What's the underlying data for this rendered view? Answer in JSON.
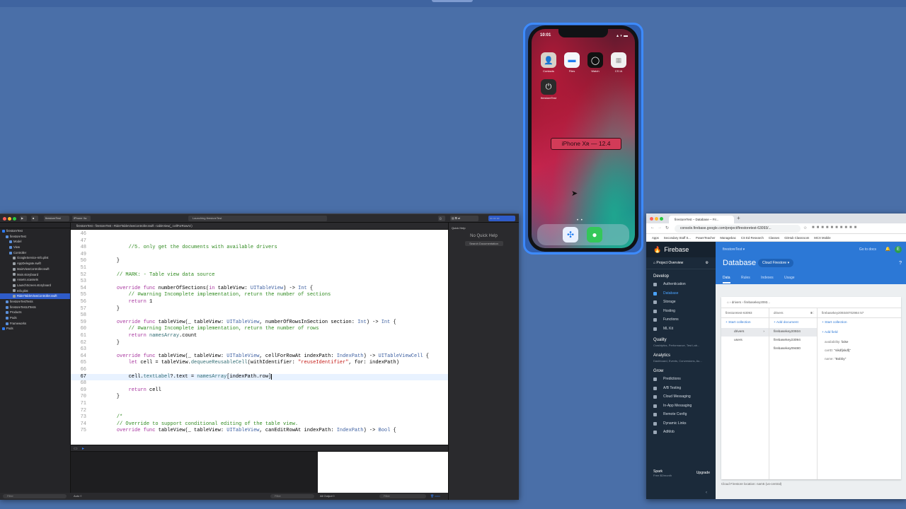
{
  "simulator": {
    "time": "10:01",
    "label": "iPhone Xʀ — 12.4",
    "apps": [
      {
        "name": "Contacts",
        "icon": "contacts-icon"
      },
      {
        "name": "Files",
        "icon": "files-icon"
      },
      {
        "name": "Watch",
        "icon": "watch-icon"
      },
      {
        "name": "CS IA",
        "icon": "cs-ia-icon"
      },
      {
        "name": "firestoreTest",
        "icon": "power-icon"
      }
    ],
    "dock": [
      {
        "name": "Safari",
        "icon": "safari-icon"
      },
      {
        "name": "Messages",
        "icon": "messages-icon"
      }
    ]
  },
  "xcode": {
    "scheme": "firestoreTest",
    "device": "iPhone Xʀ",
    "status": "Launching firestoreTest",
    "jump_bar": "firestoreTest  ›  firestoreTest  ›  RiderTableViewController.swift  ›  tableView(_:cellForRowAt:)",
    "navigator": [
      {
        "label": "firestoreTest",
        "indent": 0,
        "kind": "project"
      },
      {
        "label": "firestoreTest",
        "indent": 1,
        "kind": "folder"
      },
      {
        "label": "Model",
        "indent": 2,
        "kind": "folder"
      },
      {
        "label": "View",
        "indent": 2,
        "kind": "folder"
      },
      {
        "label": "Controller",
        "indent": 2,
        "kind": "folder"
      },
      {
        "label": "GoogleService-Info.plist",
        "indent": 3,
        "kind": "file"
      },
      {
        "label": "AppDelegate.swift",
        "indent": 3,
        "kind": "file"
      },
      {
        "label": "MainViewController.swift",
        "indent": 3,
        "kind": "file"
      },
      {
        "label": "Main.storyboard",
        "indent": 3,
        "kind": "file"
      },
      {
        "label": "Assets.xcassets",
        "indent": 3,
        "kind": "file"
      },
      {
        "label": "LaunchScreen.storyboard",
        "indent": 3,
        "kind": "file"
      },
      {
        "label": "Info.plist",
        "indent": 3,
        "kind": "file"
      },
      {
        "label": "RiderTableViewController.swift",
        "indent": 3,
        "kind": "file",
        "selected": true
      },
      {
        "label": "firestoreTestTests",
        "indent": 1,
        "kind": "folder"
      },
      {
        "label": "firestoreTestUITests",
        "indent": 1,
        "kind": "folder"
      },
      {
        "label": "Products",
        "indent": 1,
        "kind": "folder"
      },
      {
        "label": "Pods",
        "indent": 1,
        "kind": "folder"
      },
      {
        "label": "Frameworks",
        "indent": 1,
        "kind": "folder"
      },
      {
        "label": "Pods",
        "indent": 0,
        "kind": "project"
      }
    ],
    "quick_help_title": "Quick Help",
    "quick_help_empty": "No Quick Help",
    "search_documentation": "Search Documentation",
    "filter_placeholder": "Filter",
    "output_selector": "All Output ◊",
    "auto_label": "Auto ◊",
    "code": [
      {
        "n": "46",
        "text": ""
      },
      {
        "n": "47",
        "text": ""
      },
      {
        "n": "48",
        "text": "        //5. only get the documents with available drivers"
      },
      {
        "n": "49",
        "text": ""
      },
      {
        "n": "50",
        "text": "    }"
      },
      {
        "n": "51",
        "text": ""
      },
      {
        "n": "52",
        "text": "    // MARK: - Table view data source"
      },
      {
        "n": "53",
        "text": ""
      },
      {
        "n": "54",
        "text": "    override func numberOfSections(in tableView: UITableView) -> Int {"
      },
      {
        "n": "55",
        "text": "        // #warning Incomplete implementation, return the number of sections"
      },
      {
        "n": "56",
        "text": "        return 1"
      },
      {
        "n": "57",
        "text": "    }"
      },
      {
        "n": "58",
        "text": ""
      },
      {
        "n": "59",
        "text": "    override func tableView(_ tableView: UITableView, numberOfRowsInSection section: Int) -> Int {"
      },
      {
        "n": "60",
        "text": "        // #warning Incomplete implementation, return the number of rows"
      },
      {
        "n": "61",
        "text": "        return namesArray.count"
      },
      {
        "n": "62",
        "text": "    }"
      },
      {
        "n": "63",
        "text": ""
      },
      {
        "n": "64",
        "text": "    override func tableView(_ tableView: UITableView, cellForRowAt indexPath: IndexPath) -> UITableViewCell {"
      },
      {
        "n": "65",
        "text": "        let cell = tableView.dequeueReusableCell(withIdentifier: \"reuseIdentifier\", for: indexPath)"
      },
      {
        "n": "66",
        "text": ""
      },
      {
        "n": "67",
        "text": "        cell.textLabel?.text = namesArray[indexPath.row]",
        "active": true
      },
      {
        "n": "68",
        "text": ""
      },
      {
        "n": "69",
        "text": "        return cell"
      },
      {
        "n": "70",
        "text": "    }"
      },
      {
        "n": "71",
        "text": ""
      },
      {
        "n": "72",
        "text": ""
      },
      {
        "n": "73",
        "text": "    /*"
      },
      {
        "n": "74",
        "text": "    // Override to support conditional editing of the table view."
      },
      {
        "n": "75",
        "text": "    override func tableView(_ tableView: UITableView, canEditRowAt indexPath: IndexPath) -> Bool {"
      }
    ]
  },
  "browser": {
    "tab_title": "firestoreTest – Database – Fir...",
    "url": "console.firebase.google.com/project/firestoretest-63093/...",
    "bookmarks": [
      "Apps",
      "Secondary Staff S...",
      "PowerTeacher",
      "Managebac",
      "CS Ed Research",
      "Classes",
      "GitHub Classroom",
      "MCX Mobile"
    ]
  },
  "firebase": {
    "brand": "Firebase",
    "project_overview": "Project Overview",
    "develop": "Develop",
    "develop_items": [
      "Authentication",
      "Database",
      "Storage",
      "Hosting",
      "Functions",
      "ML Kit"
    ],
    "active_item": "Database",
    "quality": "Quality",
    "quality_sub": "Crashlytics, Performance, Test Lab...",
    "analytics": "Analytics",
    "analytics_sub": "Dashboard, Events, Conversions, Au...",
    "grow": "Grow",
    "grow_items": [
      "Predictions",
      "A/B Testing",
      "Cloud Messaging",
      "In-App Messaging",
      "Remote Config",
      "Dynamic Links",
      "AdMob"
    ],
    "plan_name": "Spark",
    "plan_detail": "Free $0/month",
    "upgrade": "Upgrade",
    "project_selector": "firestoreTest ▾",
    "go_to_docs": "Go to docs",
    "avatar_letter": "E",
    "title": "Database",
    "db_selector": "Cloud Firestore ▾",
    "tabs": [
      "Data",
      "Rules",
      "Indexes",
      "Usage"
    ],
    "active_tab": "Data",
    "breadcrumb": "⌂  ›  drivers  ›  firebasekey2093...",
    "col1_header": "firestoretest-63093",
    "col2_header": "drivers",
    "col3_header": "firebasekey209348702984 57",
    "start_collection": "+ Start collection",
    "add_document": "+ Add document",
    "add_field": "+ Add field",
    "collections": [
      "drivers",
      "users"
    ],
    "documents": [
      "firebasekey20934",
      "firebasekey23094",
      "firebasekey09480"
    ],
    "fields": [
      {
        "key": "availability:",
        "value": "false"
      },
      {
        "key": "carID:",
        "value": "\"sikdfjskdfj\""
      },
      {
        "key": "name:",
        "value": "\"Bobby\""
      }
    ],
    "location": "Cloud Firestore location: nam5 (us-central)"
  }
}
